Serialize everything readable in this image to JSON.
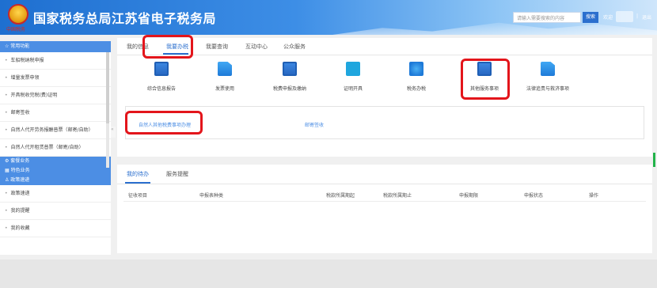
{
  "header": {
    "title": "国家税务总局江苏省电子税务局",
    "logo_subtitle": "中国税务",
    "search_placeholder": "请输入需要搜索的内容",
    "search_button": "搜索",
    "welcome": "欢迎",
    "separator": "|",
    "logout": "退出"
  },
  "sidebar": {
    "section_title": "常用功能",
    "items": [
      "车船税纳税申报",
      "增量发票申领",
      "开具税收完税(费)证明",
      "邮寄签收",
      "自然人代开劳务报酬普票（邮寄/自助）",
      "自然人代开租赁普票（邮寄/自助）"
    ],
    "groups": [
      "套餐业务",
      "特色业务",
      "政策速递"
    ],
    "extra_items": [
      "政策速递",
      "我的提醒",
      "我的收藏"
    ],
    "collapse_icon": "«"
  },
  "main_tabs": [
    {
      "label": "我的信息",
      "active": false
    },
    {
      "label": "我要办税",
      "active": true
    },
    {
      "label": "我要查询",
      "active": false
    },
    {
      "label": "互动中心",
      "active": false
    },
    {
      "label": "公众服务",
      "active": false
    }
  ],
  "icons": [
    {
      "label": "综合信息报告",
      "icon": "monitor-chart-icon"
    },
    {
      "label": "发票使用",
      "icon": "invoice-doc-icon"
    },
    {
      "label": "税费申报及缴纳",
      "icon": "monitor-declare-icon"
    },
    {
      "label": "证明开具",
      "icon": "certificate-icon"
    },
    {
      "label": "税务办税",
      "icon": "globe-icon"
    },
    {
      "label": "其他服务事项",
      "icon": "monitor-trend-icon"
    },
    {
      "label": "法律追责与救济事项",
      "icon": "legal-doc-icon"
    }
  ],
  "subpanel": {
    "links": [
      "自然人其他税费事项办理",
      "邮寄签收"
    ]
  },
  "bottom_tabs": [
    {
      "label": "我的待办",
      "active": true
    },
    {
      "label": "服务提醒",
      "active": false
    }
  ],
  "table_headers": [
    "征收项目",
    "申报表种类",
    "税款所属期起",
    "税款所属期止",
    "申报期限",
    "申报状态",
    "操作"
  ],
  "colors": {
    "accent": "#2b6fce",
    "highlight": "#e3151b",
    "sidebar_header": "#4c8ee4"
  }
}
